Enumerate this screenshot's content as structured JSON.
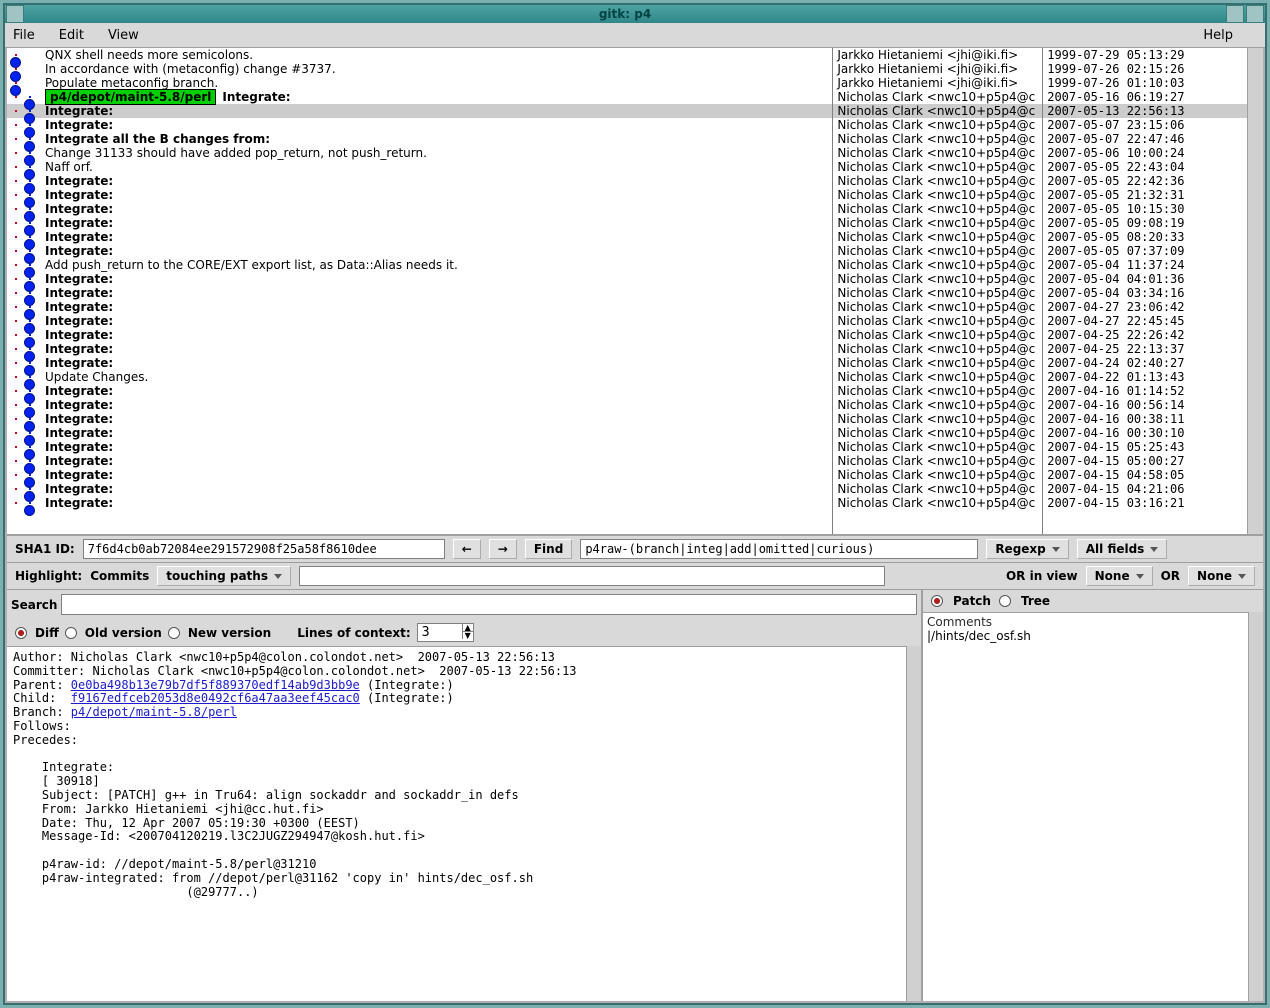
{
  "window": {
    "title": "gitk: p4"
  },
  "menu": {
    "file": "File",
    "edit": "Edit",
    "view": "View",
    "help": "Help"
  },
  "commits": [
    {
      "graph": "first",
      "msg": "QNX shell needs more semicolons.",
      "author": "Jarkko Hietaniemi <jhi@iki.fi>",
      "date": "1999-07-29 05:13:29"
    },
    {
      "graph": "first",
      "msg": "In accordance with (metaconfig) change #3737.",
      "author": "Jarkko Hietaniemi <jhi@iki.fi>",
      "date": "1999-07-26 02:15:26"
    },
    {
      "graph": "first",
      "msg": "Populate metaconfig branch.",
      "author": "Jarkko Hietaniemi <jhi@iki.fi>",
      "date": "1999-07-26 01:10:03"
    },
    {
      "graph": "branch",
      "tag": "p4/depot/maint-5.8/perl",
      "msg": "Integrate:",
      "bold": true,
      "author": "Nicholas Clark <nwc10+p5p4@c",
      "date": "2007-05-16 06:19:27"
    },
    {
      "graph": "branch",
      "msg": "Integrate:",
      "bold": true,
      "sel": true,
      "author": "Nicholas Clark <nwc10+p5p4@c",
      "date": "2007-05-13 22:56:13"
    },
    {
      "graph": "branch",
      "msg": "Integrate:",
      "bold": true,
      "author": "Nicholas Clark <nwc10+p5p4@c",
      "date": "2007-05-07 23:15:06"
    },
    {
      "graph": "branch",
      "msg": "Integrate all the B changes from:",
      "bold": true,
      "author": "Nicholas Clark <nwc10+p5p4@c",
      "date": "2007-05-07 22:47:46"
    },
    {
      "graph": "branch",
      "msg": "Change 31133 should have added pop_return, not push_return.",
      "author": "Nicholas Clark <nwc10+p5p4@c",
      "date": "2007-05-06 10:00:24"
    },
    {
      "graph": "branch",
      "msg": "Naff orf.",
      "author": "Nicholas Clark <nwc10+p5p4@c",
      "date": "2007-05-05 22:43:04"
    },
    {
      "graph": "branch",
      "msg": "Integrate:",
      "bold": true,
      "author": "Nicholas Clark <nwc10+p5p4@c",
      "date": "2007-05-05 22:42:36"
    },
    {
      "graph": "branch",
      "msg": "Integrate:",
      "bold": true,
      "author": "Nicholas Clark <nwc10+p5p4@c",
      "date": "2007-05-05 21:32:31"
    },
    {
      "graph": "branch",
      "msg": "Integrate:",
      "bold": true,
      "author": "Nicholas Clark <nwc10+p5p4@c",
      "date": "2007-05-05 10:15:30"
    },
    {
      "graph": "branch",
      "msg": "Integrate:",
      "bold": true,
      "author": "Nicholas Clark <nwc10+p5p4@c",
      "date": "2007-05-05 09:08:19"
    },
    {
      "graph": "branch",
      "msg": "Integrate:",
      "bold": true,
      "author": "Nicholas Clark <nwc10+p5p4@c",
      "date": "2007-05-05 08:20:33"
    },
    {
      "graph": "branch",
      "msg": "Integrate:",
      "bold": true,
      "author": "Nicholas Clark <nwc10+p5p4@c",
      "date": "2007-05-05 07:37:09"
    },
    {
      "graph": "branch",
      "msg": "Add push_return to the CORE/EXT export list, as Data::Alias needs it.",
      "author": "Nicholas Clark <nwc10+p5p4@c",
      "date": "2007-05-04 11:37:24"
    },
    {
      "graph": "branch",
      "msg": "Integrate:",
      "bold": true,
      "author": "Nicholas Clark <nwc10+p5p4@c",
      "date": "2007-05-04 04:01:36"
    },
    {
      "graph": "branch",
      "msg": "Integrate:",
      "bold": true,
      "author": "Nicholas Clark <nwc10+p5p4@c",
      "date": "2007-05-04 03:34:16"
    },
    {
      "graph": "branch",
      "msg": "Integrate:",
      "bold": true,
      "author": "Nicholas Clark <nwc10+p5p4@c",
      "date": "2007-04-27 23:06:42"
    },
    {
      "graph": "branch",
      "msg": "Integrate:",
      "bold": true,
      "author": "Nicholas Clark <nwc10+p5p4@c",
      "date": "2007-04-27 22:45:45"
    },
    {
      "graph": "branch",
      "msg": "Integrate:",
      "bold": true,
      "author": "Nicholas Clark <nwc10+p5p4@c",
      "date": "2007-04-25 22:26:42"
    },
    {
      "graph": "branch",
      "msg": "Integrate:",
      "bold": true,
      "author": "Nicholas Clark <nwc10+p5p4@c",
      "date": "2007-04-25 22:13:37"
    },
    {
      "graph": "branch",
      "msg": "Integrate:",
      "bold": true,
      "author": "Nicholas Clark <nwc10+p5p4@c",
      "date": "2007-04-24 02:40:27"
    },
    {
      "graph": "branch",
      "msg": "Update Changes.",
      "author": "Nicholas Clark <nwc10+p5p4@c",
      "date": "2007-04-22 01:13:43"
    },
    {
      "graph": "branch",
      "msg": "Integrate:",
      "bold": true,
      "author": "Nicholas Clark <nwc10+p5p4@c",
      "date": "2007-04-16 01:14:52"
    },
    {
      "graph": "branch",
      "msg": "Integrate:",
      "bold": true,
      "author": "Nicholas Clark <nwc10+p5p4@c",
      "date": "2007-04-16 00:56:14"
    },
    {
      "graph": "branch",
      "msg": "Integrate:",
      "bold": true,
      "author": "Nicholas Clark <nwc10+p5p4@c",
      "date": "2007-04-16 00:38:11"
    },
    {
      "graph": "branch",
      "msg": "Integrate:",
      "bold": true,
      "author": "Nicholas Clark <nwc10+p5p4@c",
      "date": "2007-04-16 00:30:10"
    },
    {
      "graph": "branch",
      "msg": "Integrate:",
      "bold": true,
      "author": "Nicholas Clark <nwc10+p5p4@c",
      "date": "2007-04-15 05:25:43"
    },
    {
      "graph": "branch",
      "msg": "Integrate:",
      "bold": true,
      "author": "Nicholas Clark <nwc10+p5p4@c",
      "date": "2007-04-15 05:00:27"
    },
    {
      "graph": "branch",
      "msg": "Integrate:",
      "bold": true,
      "author": "Nicholas Clark <nwc10+p5p4@c",
      "date": "2007-04-15 04:58:05"
    },
    {
      "graph": "branch",
      "msg": "Integrate:",
      "bold": true,
      "author": "Nicholas Clark <nwc10+p5p4@c",
      "date": "2007-04-15 04:21:06"
    },
    {
      "graph": "branch",
      "msg": "Integrate:",
      "bold": true,
      "author": "Nicholas Clark <nwc10+p5p4@c",
      "date": "2007-04-15 03:16:21"
    }
  ],
  "sha_row": {
    "label": "SHA1 ID:",
    "value": "7f6d4cb0ab72084ee291572908f25a58f8610dee",
    "find_label": "Find",
    "find_value": "p4raw-(branch|integ|add|omitted|curious)",
    "regexp_label": "Regexp",
    "allfields_label": "All fields"
  },
  "hl_row": {
    "label": "Highlight:",
    "commits_label": "Commits",
    "tp_label": "touching paths",
    "orinview": "OR in view",
    "none1": "None",
    "or": "OR",
    "none2": "None"
  },
  "search": {
    "label": "Search"
  },
  "diff_row": {
    "diff": "Diff",
    "old": "Old version",
    "new": "New version",
    "ctx_label": "Lines of context:",
    "ctx_value": "3"
  },
  "details": {
    "author_label": "Author: ",
    "author": "Nicholas Clark <nwc10+p5p4@colon.colondot.net>  2007-05-13 22:56:13",
    "committer_label": "Committer: ",
    "committer": "Nicholas Clark <nwc10+p5p4@colon.colondot.net>  2007-05-13 22:56:13",
    "parent_label": "Parent: ",
    "parent": "0e0ba498b13e79b7df5f889370edf14ab9d3bb9e",
    "parent_tail": " (Integrate:)",
    "child_label": "Child:  ",
    "child": "f9167edfceb2053d8e0492cf6a47aa3eef45cac0",
    "child_tail": " (Integrate:)",
    "branch_label": "Branch: ",
    "branch": "p4/depot/maint-5.8/perl",
    "follows": "Follows:",
    "precedes": "Precedes:",
    "body": "    Integrate:\n    [ 30918]\n    Subject: [PATCH] g++ in Tru64: align sockaddr and sockaddr_in defs\n    From: Jarkko Hietaniemi <jhi@cc.hut.fi>\n    Date: Thu, 12 Apr 2007 05:19:30 +0300 (EEST)\n    Message-Id: <200704120219.l3C2JUGZ294947@kosh.hut.fi>\n\n    p4raw-id: //depot/maint-5.8/perl@31210\n    p4raw-integrated: from //depot/perl@31162 'copy in' hints/dec_osf.sh\n                        (@29777..)"
  },
  "patch_row": {
    "patch": "Patch",
    "tree": "Tree"
  },
  "files": {
    "comments": "Comments",
    "f1": "|/hints/dec_osf.sh"
  }
}
